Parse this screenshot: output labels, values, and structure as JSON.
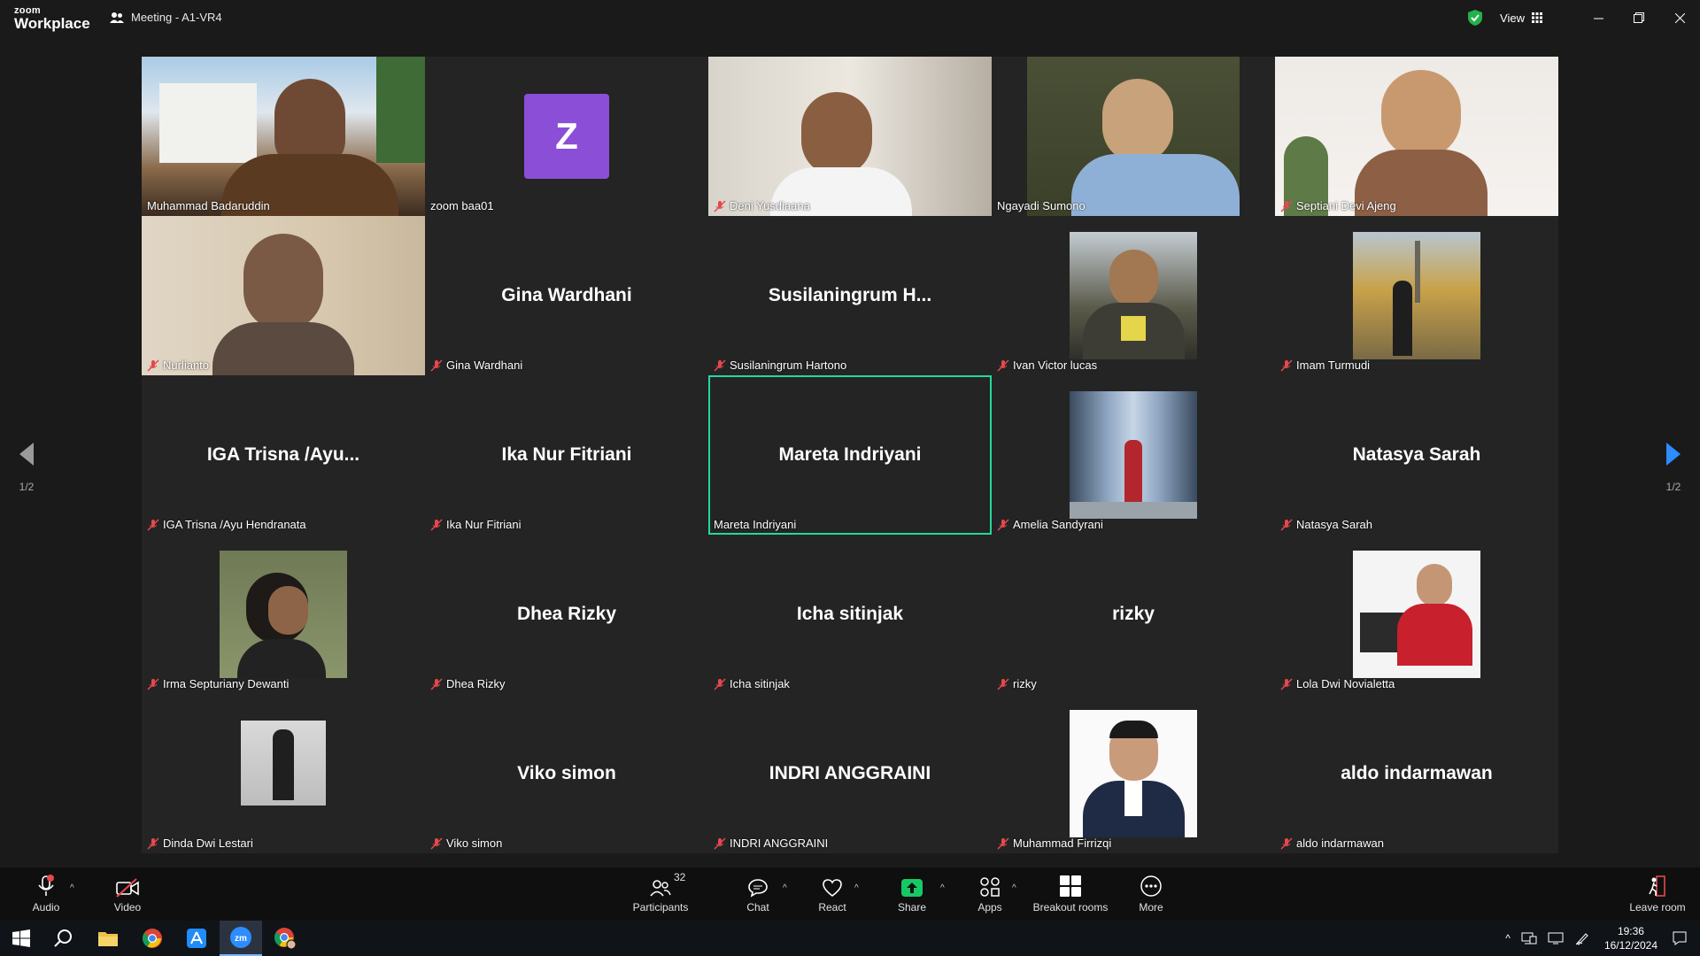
{
  "titlebar": {
    "logo_line1": "zoom",
    "logo_line2": "Workplace",
    "meeting_title": "Meeting - A1-VR4",
    "view_label": "View"
  },
  "gallery": {
    "page_indicator_left": "1/2",
    "page_indicator_right": "1/2",
    "tiles": [
      {
        "name": "Muhammad Badaruddin",
        "display": "video",
        "muted": false
      },
      {
        "name": "zoom baa01",
        "display": "avatar",
        "avatar_letter": "Z",
        "avatar_color": "#8a4fd6",
        "muted": false
      },
      {
        "name": "Deni Yusdiaana",
        "display": "video",
        "muted": true
      },
      {
        "name": "Ngayadi Sumono",
        "display": "video",
        "muted": false
      },
      {
        "name": "Septiani Devi Ajeng",
        "display": "video",
        "muted": true
      },
      {
        "name": "Nurlianto",
        "display": "video",
        "muted": true
      },
      {
        "name": "Gina Wardhani",
        "display": "name",
        "center_text": "Gina Wardhani",
        "muted": true
      },
      {
        "name": "Susilaningrum Hartono",
        "display": "name",
        "center_text": "Susilaningrum  H...",
        "muted": true
      },
      {
        "name": "Ivan Victor lucas",
        "display": "photo",
        "muted": true
      },
      {
        "name": "Imam Turmudi",
        "display": "photo",
        "muted": true
      },
      {
        "name": "IGA Trisna /Ayu Hendranata",
        "display": "name",
        "center_text": "IGA Trisna /Ayu...",
        "muted": true
      },
      {
        "name": "Ika Nur Fitriani",
        "display": "name",
        "center_text": "Ika Nur Fitriani",
        "muted": true
      },
      {
        "name": "Mareta Indriyani",
        "display": "name",
        "center_text": "Mareta Indriyani",
        "muted": false,
        "active_speaker": true
      },
      {
        "name": "Amelia Sandyrani",
        "display": "photo",
        "muted": true
      },
      {
        "name": "Natasya Sarah",
        "display": "name",
        "center_text": "Natasya Sarah",
        "muted": true
      },
      {
        "name": "Irma Septuriany Dewanti",
        "display": "photo",
        "muted": true
      },
      {
        "name": "Dhea Rizky",
        "display": "name",
        "center_text": "Dhea Rizky",
        "muted": true
      },
      {
        "name": "Icha sitinjak",
        "display": "name",
        "center_text": "Icha sitinjak",
        "muted": true
      },
      {
        "name": "rizky",
        "display": "name",
        "center_text": "rizky",
        "muted": true
      },
      {
        "name": "Lola Dwi Novialetta",
        "display": "photo",
        "muted": true
      },
      {
        "name": "Dinda Dwi Lestari",
        "display": "photo",
        "muted": true
      },
      {
        "name": "Viko simon",
        "display": "name",
        "center_text": "Viko simon",
        "muted": true
      },
      {
        "name": "INDRI ANGGRAINI",
        "display": "name",
        "center_text": "INDRI ANGGRAINI",
        "muted": true
      },
      {
        "name": "Muhammad Firrizqi",
        "display": "photo",
        "muted": true
      },
      {
        "name": "aldo indarmawan",
        "display": "name",
        "center_text": "aldo indarmawan",
        "muted": true
      }
    ]
  },
  "toolbar": {
    "audio": "Audio",
    "video": "Video",
    "participants": "Participants",
    "participants_count": "32",
    "chat": "Chat",
    "react": "React",
    "share": "Share",
    "apps": "Apps",
    "breakout": "Breakout rooms",
    "more": "More",
    "leave": "Leave room"
  },
  "taskbar": {
    "time": "19:36",
    "date": "16/12/2024",
    "apps": [
      "start-icon",
      "search-icon",
      "file-explorer-icon",
      "chrome-icon",
      "app-store-icon",
      "zoom-icon",
      "chrome-profile-icon"
    ]
  },
  "colors": {
    "active_speaker_border": "#23d9a0",
    "mute_red": "#e5484d",
    "share_green": "#17c964",
    "background": "#1a1a1a",
    "tile_bg": "#242424"
  }
}
